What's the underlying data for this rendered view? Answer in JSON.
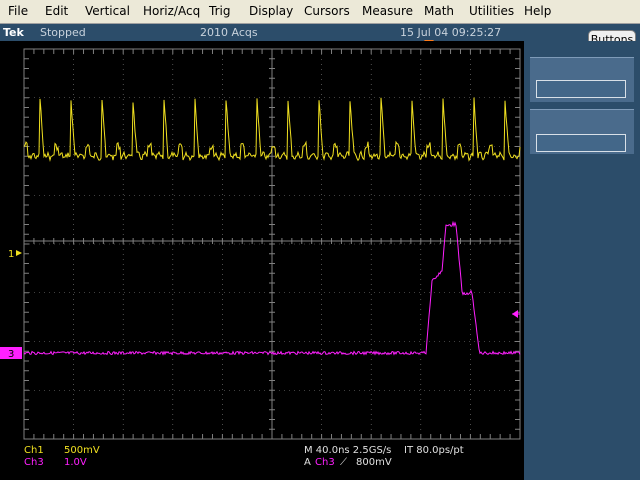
{
  "menu": [
    "File",
    "Edit",
    "Vertical",
    "Horiz/Acq",
    "Trig",
    "Display",
    "Cursors",
    "Measure",
    "Math",
    "Utilities",
    "Help"
  ],
  "status": {
    "brand": "Tek",
    "run_state": "Stopped",
    "acquisitions": "2010 Acqs",
    "datetime": "15 Jul 04 09:25:27"
  },
  "buttons_label": "Buttons",
  "markers": {
    "ch1": "1",
    "ch3": "3"
  },
  "readout": {
    "ch1_label": "Ch1",
    "ch1_scale": "500mV",
    "ch3_label": "Ch3",
    "ch3_scale": "1.0V",
    "timebase": "M 40.0ns 2.5GS/s",
    "interp": "IT 80.0ps/pt",
    "trig_prefix": "A",
    "trig_source": "Ch3",
    "trig_slope": "⟋",
    "trig_level": "800mV"
  },
  "colors": {
    "ch1": "#f0e020",
    "ch3": "#ff20ff",
    "grid": "#808080",
    "panel": "#2c4d6a"
  }
}
